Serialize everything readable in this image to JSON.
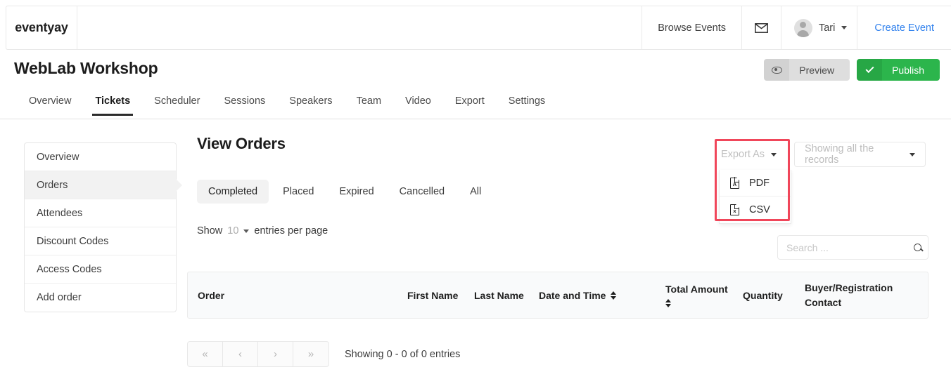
{
  "topnav": {
    "brand": "eventyay",
    "browse_events": "Browse Events",
    "mail_icon": "envelope-icon",
    "user_name": "Tari",
    "create_event": "Create Event"
  },
  "header": {
    "event_title": "WebLab Workshop",
    "preview_label": "Preview",
    "preview_icon": "eye-icon",
    "publish_label": "Publish",
    "publish_icon": "check-icon",
    "publish_color": "#2cb54c"
  },
  "tabs": [
    {
      "label": "Overview",
      "active": false
    },
    {
      "label": "Tickets",
      "active": true
    },
    {
      "label": "Scheduler",
      "active": false
    },
    {
      "label": "Sessions",
      "active": false
    },
    {
      "label": "Speakers",
      "active": false
    },
    {
      "label": "Team",
      "active": false
    },
    {
      "label": "Video",
      "active": false
    },
    {
      "label": "Export",
      "active": false
    },
    {
      "label": "Settings",
      "active": false
    }
  ],
  "sidebar": {
    "items": [
      {
        "label": "Overview",
        "active": false
      },
      {
        "label": "Orders",
        "active": true
      },
      {
        "label": "Attendees",
        "active": false
      },
      {
        "label": "Discount Codes",
        "active": false
      },
      {
        "label": "Access Codes",
        "active": false
      },
      {
        "label": "Add order",
        "active": false
      }
    ]
  },
  "main": {
    "page_title": "View Orders",
    "filters": [
      {
        "label": "Completed",
        "active": true
      },
      {
        "label": "Placed",
        "active": false
      },
      {
        "label": "Expired",
        "active": false
      },
      {
        "label": "Cancelled",
        "active": false
      },
      {
        "label": "All",
        "active": false
      }
    ],
    "show_prefix": "Show",
    "show_count": "10",
    "show_suffix": "entries per page"
  },
  "export": {
    "button_label": "Export As",
    "highlight_color": "#f0465a",
    "items": [
      {
        "label": "PDF",
        "icon": "pdf-file-icon",
        "glyph": "A"
      },
      {
        "label": "CSV",
        "icon": "csv-file-icon",
        "glyph": "x"
      }
    ]
  },
  "records_select": {
    "value": "Showing all the records"
  },
  "search": {
    "placeholder": "Search ...",
    "value": "",
    "icon": "search-icon"
  },
  "table": {
    "columns": [
      {
        "label": "Order",
        "sortable": false
      },
      {
        "label": "First Name",
        "sortable": false
      },
      {
        "label": "Last Name",
        "sortable": false
      },
      {
        "label": "Date and Time",
        "sortable": true
      },
      {
        "label": "Total Amount",
        "sortable": true
      },
      {
        "label": "Quantity",
        "sortable": false
      },
      {
        "label": "Buyer/Registration Contact",
        "sortable": false
      }
    ],
    "rows": []
  },
  "pagination": {
    "first": "«",
    "prev": "‹",
    "next": "›",
    "last": "»",
    "info": "Showing 0 - 0 of 0 entries"
  }
}
